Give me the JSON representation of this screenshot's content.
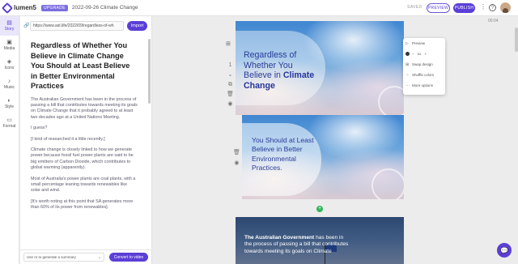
{
  "app": {
    "name": "lumen5",
    "badge": "UPGRADE",
    "project_title": "2022-09-26 Climate Change"
  },
  "header": {
    "saved": "SAVED",
    "preview": "PREVIEW",
    "publish": "PUBLISH"
  },
  "nav": [
    {
      "label": "Story",
      "icon": "story-icon",
      "active": true
    },
    {
      "label": "Media",
      "icon": "media-icon"
    },
    {
      "label": "Icons",
      "icon": "icons-icon"
    },
    {
      "label": "Music",
      "icon": "music-icon"
    },
    {
      "label": "Style",
      "icon": "style-icon"
    },
    {
      "label": "Format",
      "icon": "format-icon"
    }
  ],
  "story": {
    "url": "https://www.ast.life/2022/09/regardless-of-wh",
    "import": "Import",
    "title": "Regardless of Whether You Believe in Climate Change You Should at Least Believe in Better Environmental Practices",
    "paragraphs": [
      "The Australian Government has been in the process of passing a bill that contributes towards meeting its goals on Climate Change that it probably agreed to at least two decades ago at a United Nations Meeting.",
      "I guess?",
      "[I kind of researched it a little recently.]",
      "Climate change is closely linked to how we generate power because fossil fuel power plants are said to be big emitters of Carbon Dioxide, which contributes to global warming (apparently).",
      "Most of Australia's power plants are coal plants, with a small percentage leaning towards renewables like solar and wind.",
      "[It's worth noting at this point that SA generates more than 60% of its power from renewables]."
    ],
    "ai_select": "Use AI to generate a summary",
    "convert": "Convert to video"
  },
  "canvas": {
    "duration": "00:04",
    "scene1": {
      "pre": "Regardless of Whether You Believe in ",
      "bold": "Climate Change"
    },
    "scene2": {
      "text": "You Should at Least Believe in Better Environmental Practices."
    },
    "scene3": {
      "bold": "The Australian Government",
      "rest": " has been in the process of passing a bill that contributes towards meeting its goals on Climate"
    }
  },
  "menu": {
    "items": [
      "Preview",
      "Trim media",
      "Swap design",
      "Shuffle colors",
      "More options"
    ],
    "font_size": "1x"
  }
}
